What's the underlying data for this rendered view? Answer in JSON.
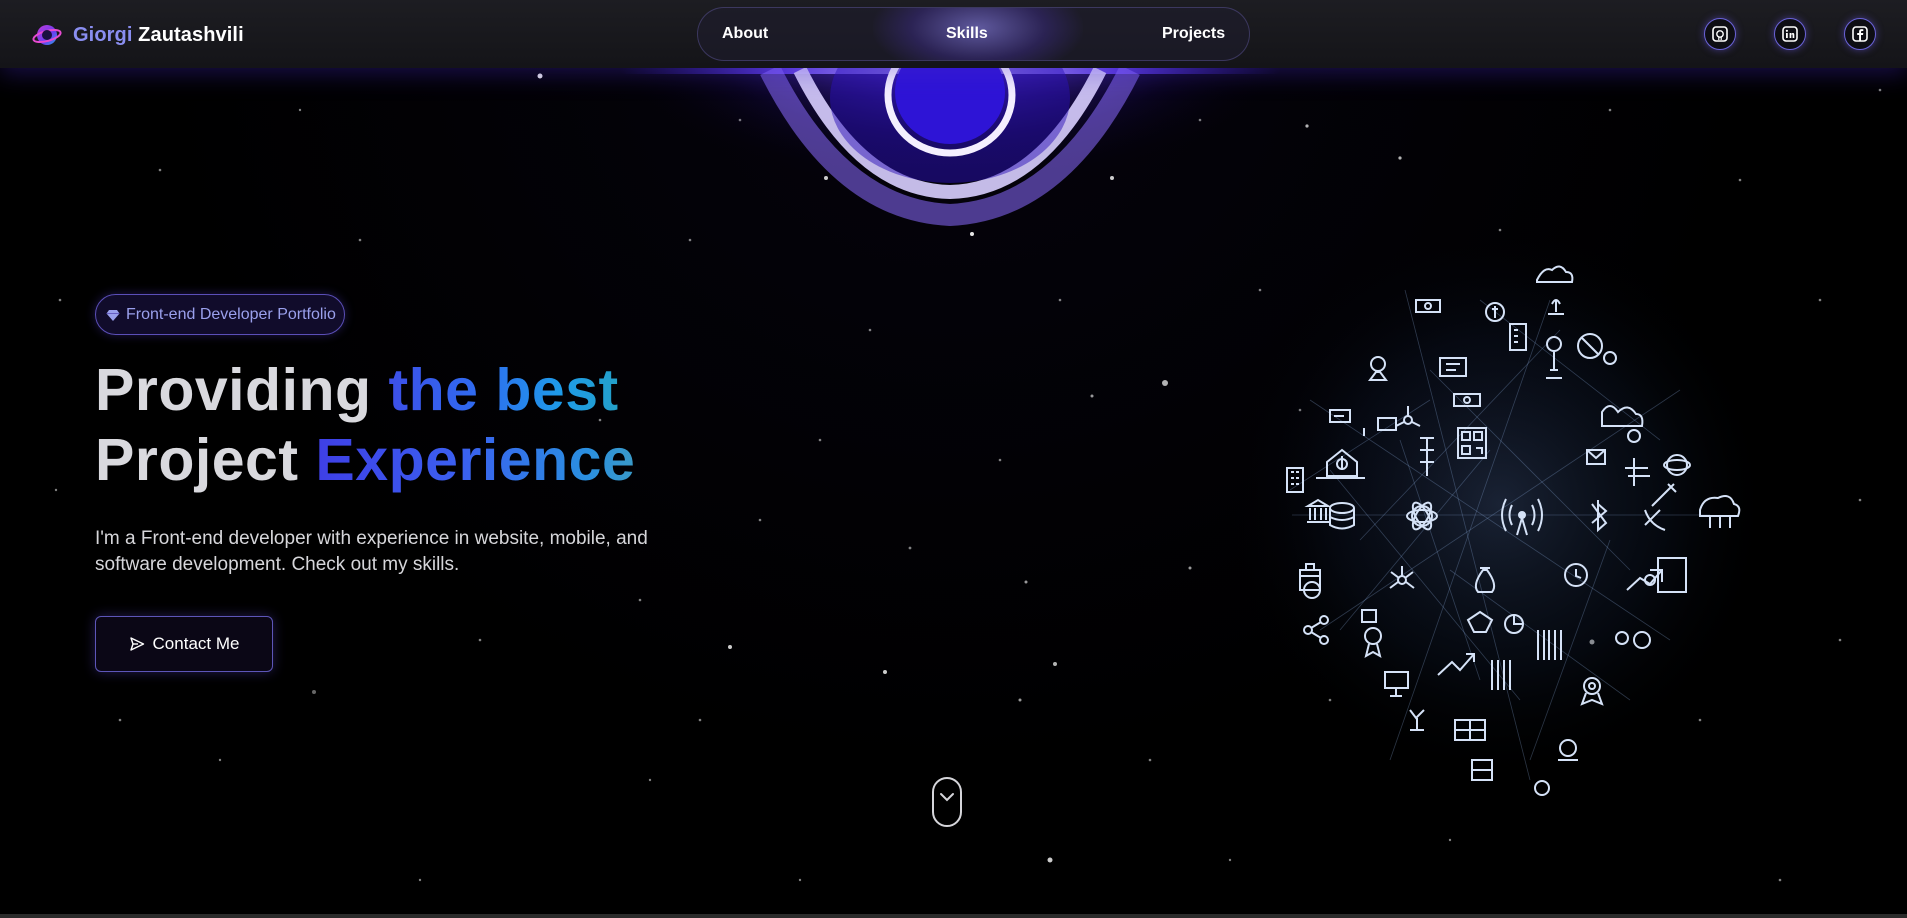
{
  "brand": {
    "first": "Giorgi",
    "last": "Zautashvili",
    "logo_icon": "planet-logo-icon"
  },
  "nav": {
    "about": "About",
    "skills": "Skills",
    "projects": "Projects"
  },
  "social": [
    {
      "name": "github",
      "icon": "github-icon"
    },
    {
      "name": "linkedin",
      "icon": "linkedin-icon"
    },
    {
      "name": "facebook",
      "icon": "facebook-icon"
    }
  ],
  "hero": {
    "badge": "Front-end Developer Portfolio",
    "headline_line1_a": "Providing ",
    "headline_line1_b": "the best",
    "headline_line2_a": "Project ",
    "headline_line2_b": "Experience",
    "description": "I'm a Front-end developer with experience in website, mobile, and software development. Check out my skills.",
    "cta": "Contact Me"
  },
  "colors": {
    "accent": "#6a63d8",
    "brand_first": "#8a8ef0",
    "gradient_start": "#3d4fe8",
    "gradient_end": "#1e9be8",
    "background": "#000000"
  }
}
